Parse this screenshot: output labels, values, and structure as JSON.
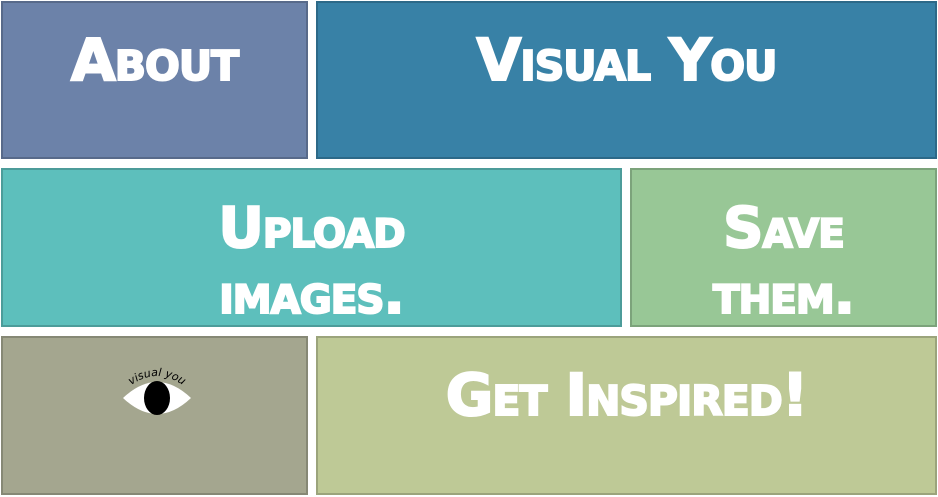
{
  "tiles": {
    "about": {
      "label": "About",
      "color": "#6c82a9"
    },
    "visual_you": {
      "label": "Visual You",
      "color": "#3881a6"
    },
    "upload": {
      "line1": "Upload",
      "line2": "images.",
      "color": "#5dbfbc"
    },
    "save": {
      "line1": "Save",
      "line2": "them.",
      "color": "#98c796"
    },
    "logo": {
      "logo_text": "visual you",
      "color": "#a4a68f"
    },
    "inspired": {
      "label": "Get Inspired!",
      "color": "#bec996"
    }
  }
}
